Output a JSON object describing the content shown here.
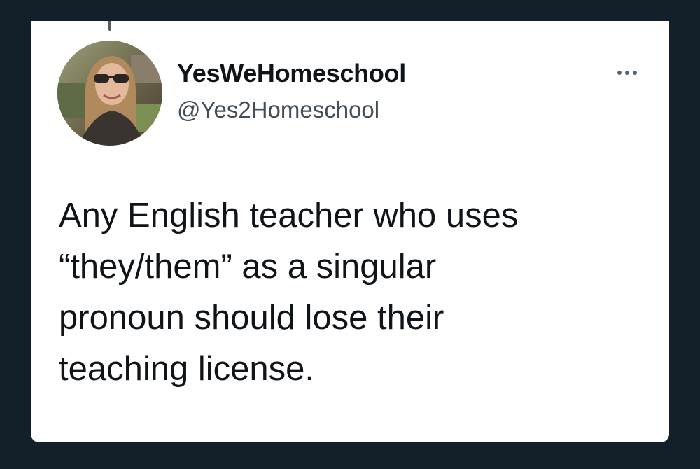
{
  "tweet": {
    "display_name": "YesWeHomeschool",
    "handle": "@Yes2Homeschool",
    "text": "Any English teacher who uses\n“they/them” as a singular\npronoun should lose their\nteaching license."
  },
  "icons": {
    "more": "more-horizontal-icon",
    "avatar": "profile-photo"
  },
  "colors": {
    "background": "#142029",
    "card": "#ffffff",
    "primary_text": "#0f1419",
    "secondary_text": "#444c54"
  }
}
